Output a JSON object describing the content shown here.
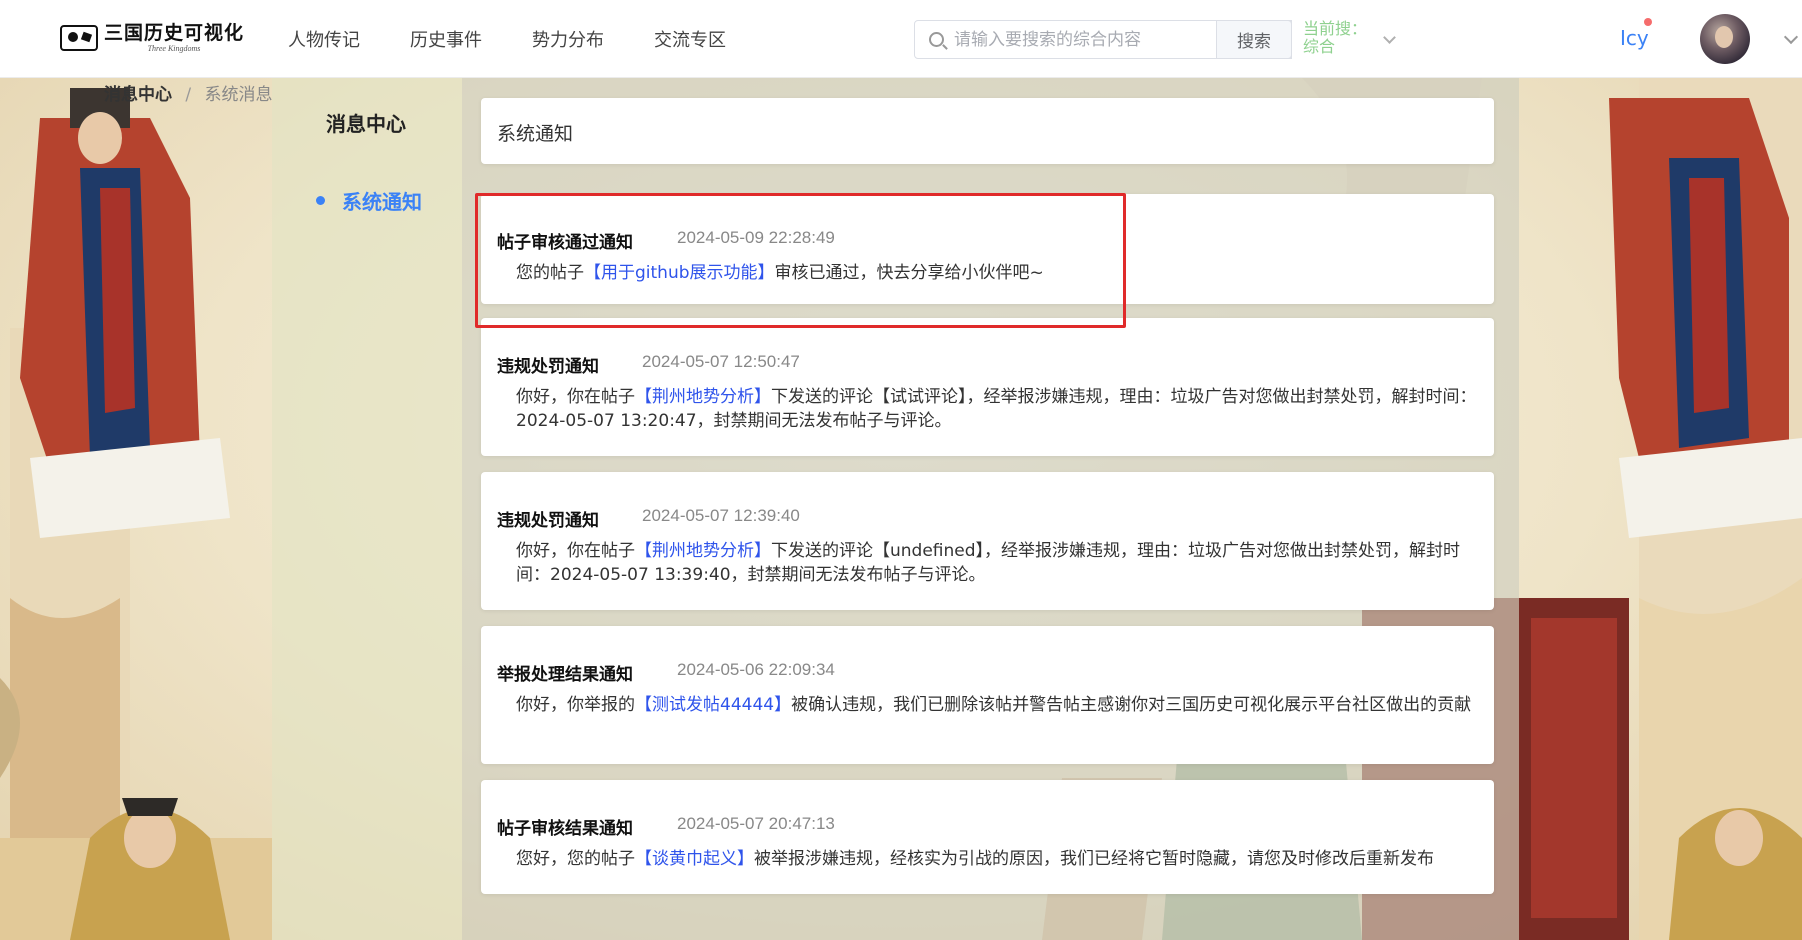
{
  "header": {
    "logo": {
      "title": "三国历史可视化",
      "subtitle": "Three Kingdoms"
    },
    "nav": [
      {
        "label": "人物传记"
      },
      {
        "label": "历史事件"
      },
      {
        "label": "势力分布"
      },
      {
        "label": "交流专区"
      }
    ],
    "search": {
      "placeholder": "请输入要搜索的综合内容",
      "button_label": "搜索",
      "scope_label": "当前搜：综合"
    },
    "user": {
      "name": "Icy",
      "has_notification": true
    }
  },
  "breadcrumb": {
    "home": "消息中心",
    "separator": "/",
    "current": "系统消息"
  },
  "sidebar": {
    "title": "消息中心",
    "items": [
      {
        "label": "系统通知",
        "active": true
      }
    ]
  },
  "main": {
    "section_title": "系统通知",
    "notifications": [
      {
        "title": "帖子审核通过通知",
        "time": "2024-05-09 22:28:49",
        "body_before": "您的帖子",
        "link": "【用于github展示功能】",
        "body_after": "审核已通过，快去分享给小伙伴吧~",
        "highlighted": true
      },
      {
        "title": "违规处罚通知",
        "time": "2024-05-07 12:50:47",
        "body_before": "你好，你在帖子",
        "link": "【荆州地势分析】",
        "body_after": "下发送的评论【试试评论】，经举报涉嫌违规，理由：垃圾广告对您做出封禁处罚，解封时间：2024-05-07 13:20:47，封禁期间无法发布帖子与评论。",
        "highlighted": false
      },
      {
        "title": "违规处罚通知",
        "time": "2024-05-07 12:39:40",
        "body_before": "你好，你在帖子",
        "link": "【荆州地势分析】",
        "body_after": "下发送的评论【undefined】，经举报涉嫌违规，理由：垃圾广告对您做出封禁处罚，解封时间：2024-05-07 13:39:40，封禁期间无法发布帖子与评论。",
        "highlighted": false
      },
      {
        "title": "举报处理结果通知",
        "time": "2024-05-06 22:09:34",
        "body_before": "你好，你举报的",
        "link": "【测试发帖44444】",
        "body_after": "被确认违规，我们已删除该帖并警告帖主感谢你对三国历史可视化展示平台社区做出的贡献",
        "highlighted": false
      },
      {
        "title": "帖子审核结果通知",
        "time": "2024-05-07 20:47:13",
        "body_before": "您好，您的帖子",
        "link": "【谈黄巾起义】",
        "body_after": "被举报涉嫌违规，经核实为引战的原因，我们已经将它暂时隐藏，请您及时修改后重新发布",
        "highlighted": false
      }
    ]
  },
  "colors": {
    "accent": "#3b82f6",
    "link": "#2f54eb",
    "highlight_border": "#e02a2a",
    "scope_label": "#8fd18f",
    "notification_dot": "#f56c6c"
  }
}
